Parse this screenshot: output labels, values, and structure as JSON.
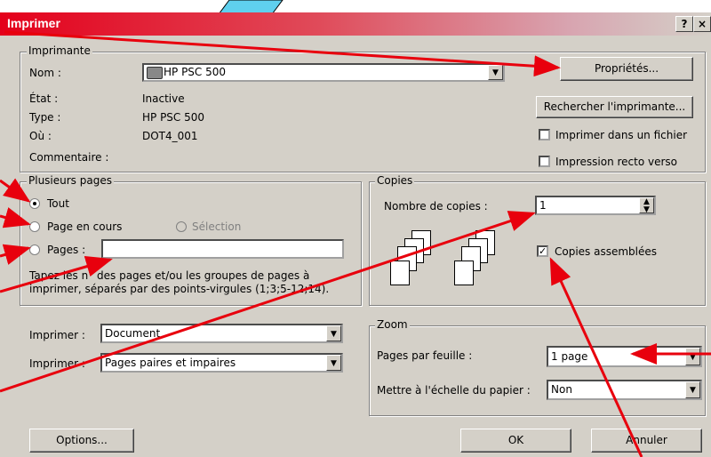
{
  "window": {
    "title": "Imprimer",
    "help_glyph": "?",
    "close_glyph": "×"
  },
  "printer": {
    "group_label": "Imprimante",
    "name_label": "Nom :",
    "name_value": "HP PSC 500",
    "state_label": "État :",
    "state_value": "Inactive",
    "type_label": "Type :",
    "type_value": "HP PSC 500",
    "where_label": "Où :",
    "where_value": "DOT4_001",
    "comment_label": "Commentaire :",
    "properties_button": "Propriétés...",
    "find_button": "Rechercher l'imprimante...",
    "print_to_file_label": "Imprimer dans un fichier",
    "duplex_label": "Impression recto verso"
  },
  "pages": {
    "group_label": "Plusieurs pages",
    "all_label": "Tout",
    "current_label": "Page en cours",
    "selection_label": "Sélection",
    "pages_label": "Pages :",
    "pages_value": "",
    "hint": "Tapez les n° des pages et/ou les groupes de pages à imprimer, séparés par des points-virgules (1;3;5-12;14)."
  },
  "copies": {
    "group_label": "Copies",
    "count_label": "Nombre de copies :",
    "count_value": "1",
    "collate_label": "Copies assemblées",
    "collate_checked": true
  },
  "print_what": {
    "label": "Imprimer :",
    "value": "Document",
    "label2": "Imprimer :",
    "value2": "Pages paires et impaires"
  },
  "zoom": {
    "group_label": "Zoom",
    "pages_per_sheet_label": "Pages par feuille :",
    "pages_per_sheet_value": "1 page",
    "scale_label": "Mettre à l'échelle du papier :",
    "scale_value": "Non"
  },
  "buttons": {
    "options": "Options...",
    "ok": "OK",
    "cancel": "Annuler"
  },
  "colors": {
    "title_bar": "#e4001b",
    "arrow": "#e8000d",
    "face": "#d4d0c8"
  }
}
